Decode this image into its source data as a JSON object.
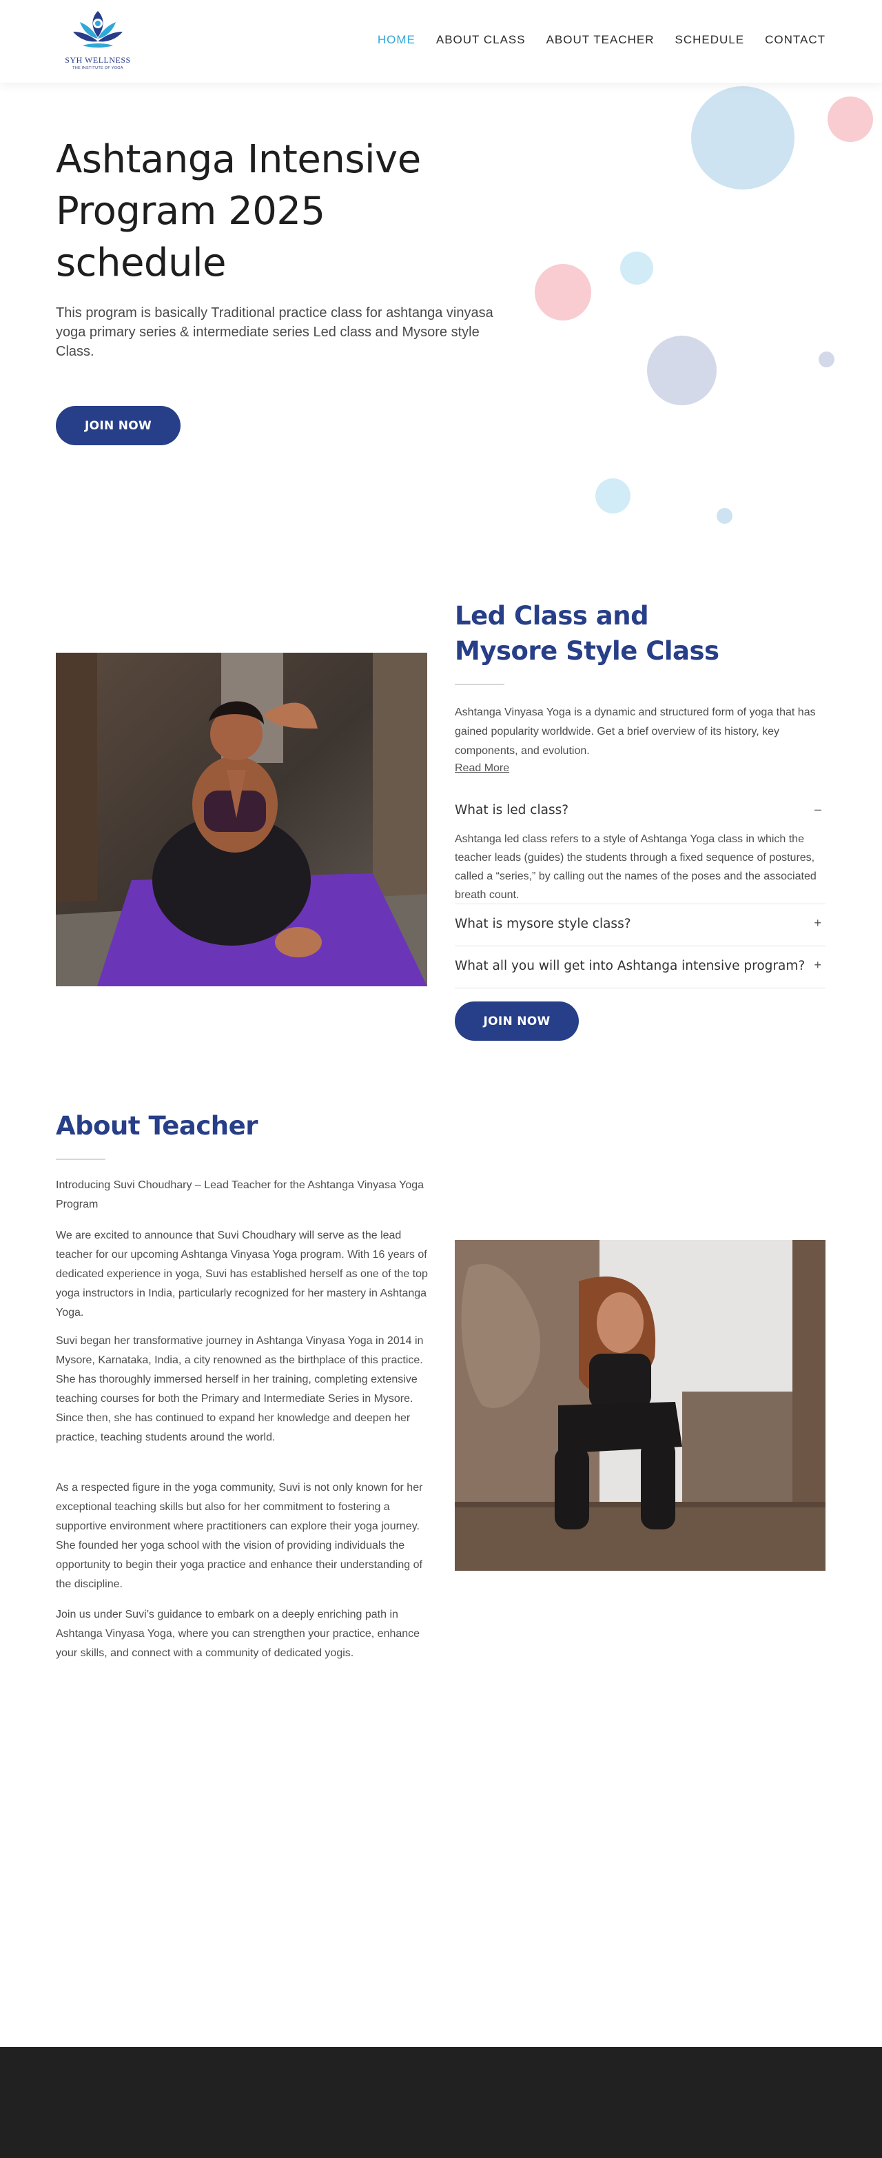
{
  "header": {
    "logo_name": "SYH WELLNESS",
    "logo_tagline": "THE INSTITUTE OF YOGA",
    "nav": [
      {
        "label": "HOME",
        "active": true
      },
      {
        "label": "ABOUT CLASS",
        "active": false
      },
      {
        "label": "ABOUT TEACHER",
        "active": false
      },
      {
        "label": "SCHEDULE",
        "active": false
      },
      {
        "label": "CONTACT",
        "active": false
      }
    ]
  },
  "hero": {
    "title": "Ashtanga Intensive Program 2025 schedule",
    "description": "This program is basically Traditional practice class for ashtanga vinyasa yoga primary series & intermediate series Led class and Mysore style Class.",
    "button_label": "JOIN NOW"
  },
  "class_section": {
    "title": "Led Class and Mysore Style Class",
    "intro": "Ashtanga Vinyasa Yoga is a dynamic and structured form of yoga that has gained popularity worldwide. Get a brief overview of its history, key components, and evolution.",
    "read_more": "Read More",
    "accordion": [
      {
        "question": "What is led class?",
        "sign": "–",
        "answer": "Ashtanga led class refers to a style of Ashtanga Yoga class in which the teacher leads (guides) the students through a fixed sequence of postures, called a “series,” by calling out the names of the poses and the associated breath count."
      },
      {
        "question": "What is mysore style class?",
        "sign": "+"
      },
      {
        "question": "What all you will get into Ashtanga intensive program?",
        "sign": "+"
      }
    ],
    "button_label": "JOIN NOW"
  },
  "teacher_section": {
    "title": "About Teacher",
    "paragraphs": [
      "Introducing Suvi Choudhary – Lead Teacher for the Ashtanga Vinyasa Yoga Program",
      "We are excited to announce that Suvi Choudhary will serve as the lead teacher for our upcoming Ashtanga Vinyasa Yoga program. With 16 years of dedicated experience in yoga, Suvi has established herself as one of the top yoga instructors in India, particularly recognized for her mastery in Ashtanga Yoga.",
      "Suvi began her transformative journey in Ashtanga Vinyasa Yoga in 2014 in Mysore, Karnataka, India, a city renowned as the birthplace of this practice. She has thoroughly immersed herself in her training, completing extensive teaching courses for both the Primary and Intermediate Series in Mysore. Since then, she has continued to expand her knowledge and deepen her practice, teaching students around the world.",
      "As a respected figure in the yoga community, Suvi is not only known for her exceptional teaching skills but also for her commitment to fostering a supportive environment where practitioners can explore their yoga journey. She founded her yoga school with the vision of providing individuals the opportunity to begin their yoga practice and enhance their understanding of the discipline.",
      "Join us under Suvi’s guidance to embark on a deeply enriching path in Ashtanga Vinyasa Yoga, where you can strengthen your practice, enhance your skills, and connect with a community of dedicated yogis."
    ]
  },
  "colors": {
    "brand_blue": "#273e88",
    "nav_active": "#2fa8d8",
    "footer": "#212121"
  }
}
